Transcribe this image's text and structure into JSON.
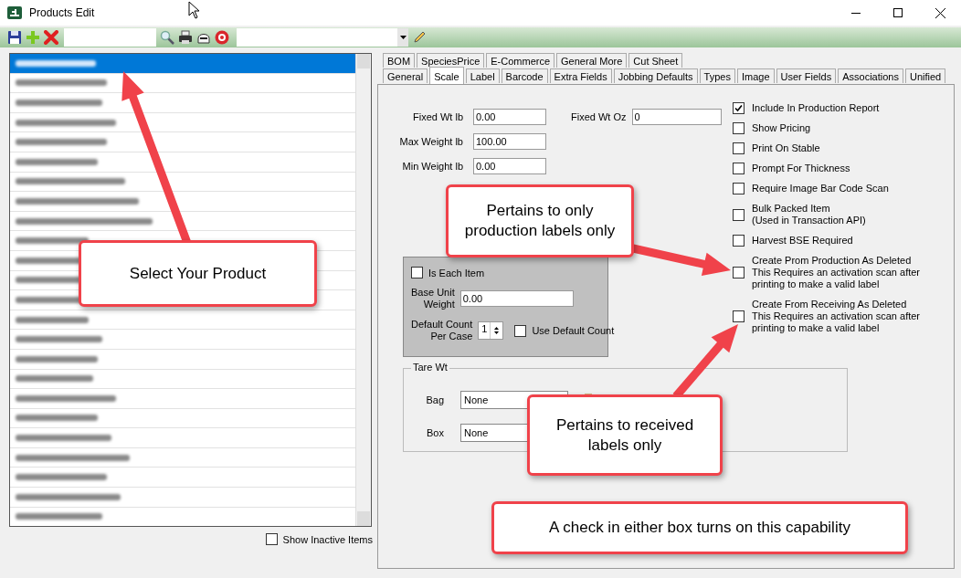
{
  "window": {
    "title": "Products Edit"
  },
  "product_list": {
    "rows": [
      {
        "selected": true
      },
      {
        "selected": false
      },
      {
        "selected": false
      },
      {
        "selected": false
      },
      {
        "selected": false
      },
      {
        "selected": false
      },
      {
        "selected": false
      },
      {
        "selected": false
      },
      {
        "selected": false
      },
      {
        "selected": false
      },
      {
        "selected": false
      },
      {
        "selected": false
      },
      {
        "selected": false
      },
      {
        "selected": false
      },
      {
        "selected": false
      },
      {
        "selected": false
      },
      {
        "selected": false
      },
      {
        "selected": false
      },
      {
        "selected": false
      },
      {
        "selected": false
      },
      {
        "selected": false
      },
      {
        "selected": false
      },
      {
        "selected": false
      },
      {
        "selected": false
      }
    ],
    "show_inactive": {
      "label": "Show Inactive Items",
      "checked": false
    }
  },
  "tabs_top": [
    {
      "label": "BOM",
      "selected": false
    },
    {
      "label": "SpeciesPrice",
      "selected": false
    },
    {
      "label": "E-Commerce",
      "selected": false
    },
    {
      "label": "General More",
      "selected": false
    },
    {
      "label": "Cut Sheet",
      "selected": false
    }
  ],
  "tabs": [
    {
      "label": "General",
      "selected": false
    },
    {
      "label": "Scale",
      "selected": true
    },
    {
      "label": "Label",
      "selected": false
    },
    {
      "label": "Barcode",
      "selected": false
    },
    {
      "label": "Extra Fields",
      "selected": false
    },
    {
      "label": "Jobbing Defaults",
      "selected": false
    },
    {
      "label": "Types",
      "selected": false
    },
    {
      "label": "Image",
      "selected": false
    },
    {
      "label": "User Fields",
      "selected": false
    },
    {
      "label": "Associations",
      "selected": false
    },
    {
      "label": "Unified",
      "selected": false
    }
  ],
  "fields": [
    {
      "label": "Fixed Wt lb",
      "value": "0.00"
    },
    {
      "label": "Max Weight lb",
      "value": "100.00"
    },
    {
      "label": "Min Weight lb",
      "value": "0.00"
    }
  ],
  "fixed_wt_oz": {
    "label": "Fixed Wt Oz",
    "value": "0"
  },
  "each_box": {
    "is_each_item": {
      "label": "Is Each Item",
      "checked": false
    },
    "base_unit_weight": {
      "label": "Base Unit\nWeight",
      "value": "0.00"
    },
    "default_count": {
      "label": "Default Count\nPer Case",
      "value": "1"
    },
    "use_default_count": {
      "label": "Use Default Count",
      "checked": false
    }
  },
  "tare_wt": {
    "title": "Tare Wt",
    "rows": [
      {
        "label": "Bag",
        "value": "None"
      },
      {
        "label": "Box",
        "value": "None"
      }
    ]
  },
  "options": [
    {
      "label": "Include In Production Report",
      "checked": true
    },
    {
      "label": "Show Pricing",
      "checked": false
    },
    {
      "label": "Print On Stable",
      "checked": false
    },
    {
      "label": "Prompt For Thickness",
      "checked": false
    },
    {
      "label": "Require Image Bar Code Scan",
      "checked": false
    },
    {
      "label": "Bulk Packed Item\n(Used in Transaction API)",
      "checked": false
    },
    {
      "label": "Harvest BSE Required",
      "checked": false
    },
    {
      "label": "Create Prom Production As Deleted\nThis Requires an activation scan after\nprinting to make a valid label",
      "checked": false
    },
    {
      "label": "Create From Receiving  As Deleted\nThis Requires an activation scan after\nprinting to make a valid label",
      "checked": false
    }
  ],
  "callouts": [
    {
      "text": "Select Your Product"
    },
    {
      "text": "Pertains to only\nproduction labels only"
    },
    {
      "text": "Pertains to received\nlabels only"
    },
    {
      "text": "A check in either box turns on this capability"
    }
  ]
}
